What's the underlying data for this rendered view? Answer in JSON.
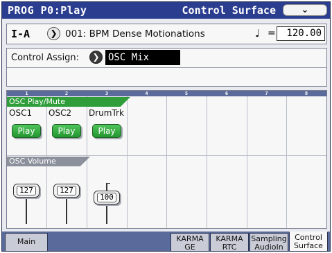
{
  "title": {
    "mode": "PROG P0:Play",
    "page": "Control Surface",
    "menu_icon": "chevron-down-icon"
  },
  "program": {
    "bank": "I-A",
    "number_name": "001: BPM Dense Motionations",
    "tempo_icon": "quarter-note-icon",
    "tempo_eq": "=",
    "tempo": "120.00"
  },
  "control_assign": {
    "label": "Control Assign:",
    "value": "OSC Mix"
  },
  "channels": [
    "1",
    "2",
    "3",
    "4",
    "5",
    "6",
    "7",
    "8"
  ],
  "osc_play_mute": {
    "label": "OSC Play/Mute",
    "tracks": [
      {
        "name": "OSC1",
        "button": "Play"
      },
      {
        "name": "OSC2",
        "button": "Play"
      },
      {
        "name": "DrumTrk",
        "button": "Play"
      }
    ]
  },
  "osc_volume": {
    "label": "OSC Volume",
    "sliders": [
      {
        "value": "127",
        "level": 1.0
      },
      {
        "value": "127",
        "level": 1.0
      },
      {
        "value": "100",
        "level": 0.79
      }
    ]
  },
  "tabs": [
    {
      "label": "Main"
    },
    {
      "label": "KARMA\nGE"
    },
    {
      "label": "KARMA\nRTC"
    },
    {
      "label": "Sampling\nAudioIn"
    },
    {
      "label": "Control\nSurface",
      "active": true
    }
  ],
  "colors": {
    "title_bar": "#2a3d8f",
    "play_green": "#2f9e3a",
    "channel_header": "#5a6a9a"
  }
}
